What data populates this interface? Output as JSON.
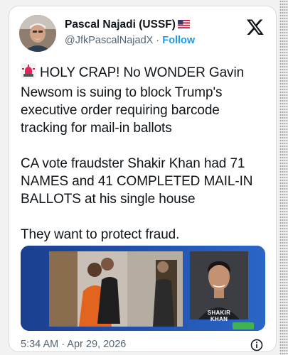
{
  "author": {
    "name": "Pascal Najadi (USSF)",
    "handle": "@JfkPascalNajadX",
    "separator": "·",
    "follow_label": "Follow"
  },
  "tweet": {
    "paragraphs": [
      "HOLY CRAP! No WONDER Gavin Newsom is suing to block Trump's executive order requiring barcode tracking for mail-in ballots",
      "CA vote fraudster Shakir Khan had 71 NAMES and 41 COMPLETED MAIL-IN BALLOTS at his single house",
      "They want to protect fraud."
    ],
    "leading_emoji": "siren-icon"
  },
  "media": {
    "caption_line1": "SHAKIR",
    "caption_line2": "KHAN",
    "accent_color": "#1e4fa3"
  },
  "timestamp": "5:34 AM · Apr 29, 2026",
  "colors": {
    "link": "#1d9bf0",
    "secondary_text": "#536471"
  }
}
